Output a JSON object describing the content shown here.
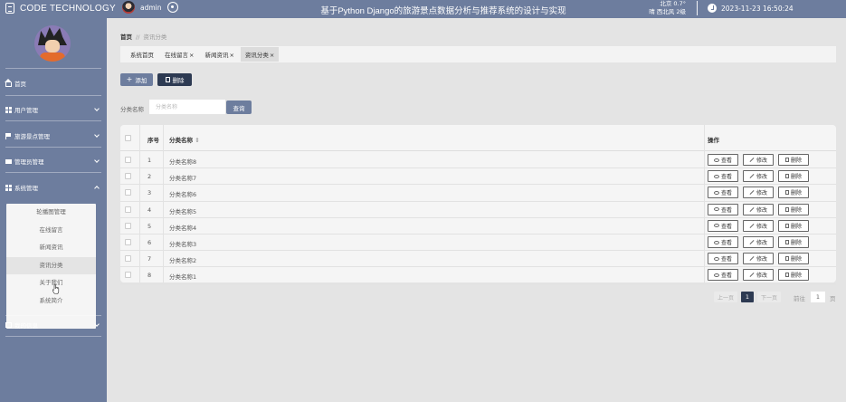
{
  "header": {
    "brand": "CODE TECHNOLOGY",
    "username": "admin",
    "title": "基于Python Django的旅游景点数据分析与推荐系统的设计与实现",
    "weather_line1": "北京 0.7°",
    "weather_line2": "晴 西北风 2级",
    "datetime": "2023-11-23 16:50:24"
  },
  "sidebar": {
    "items": [
      {
        "label": "首页"
      },
      {
        "label": "用户管理"
      },
      {
        "label": "旅游景点管理"
      },
      {
        "label": "管理员管理"
      },
      {
        "label": "系统管理"
      },
      {
        "label": "我的信息"
      }
    ],
    "submenu": [
      {
        "label": "轮播图管理"
      },
      {
        "label": "在线留言"
      },
      {
        "label": "新闻资讯"
      },
      {
        "label": "资讯分类"
      },
      {
        "label": "关于我们"
      },
      {
        "label": "系统简介"
      }
    ]
  },
  "breadcrumb": {
    "home": "首页",
    "sep": "//",
    "current": "资讯分类"
  },
  "tabs": [
    {
      "label": "系统首页",
      "closable": ""
    },
    {
      "label": "在线留言",
      "closable": "×"
    },
    {
      "label": "新闻资讯",
      "closable": "×"
    },
    {
      "label": "资讯分类",
      "closable": "×"
    }
  ],
  "toolbar": {
    "add_label": "添加",
    "add_glyph": "+",
    "delete_label": "删除"
  },
  "search": {
    "label": "分类名称",
    "placeholder": "分类名称",
    "button": "查询"
  },
  "table": {
    "headers": {
      "index": "序号",
      "name": "分类名称",
      "sort": "⇕",
      "actions": "操作"
    },
    "rows": [
      {
        "index": "1",
        "name": "分类名称8"
      },
      {
        "index": "2",
        "name": "分类名称7"
      },
      {
        "index": "3",
        "name": "分类名称6"
      },
      {
        "index": "4",
        "name": "分类名称5"
      },
      {
        "index": "5",
        "name": "分类名称4"
      },
      {
        "index": "6",
        "name": "分类名称3"
      },
      {
        "index": "7",
        "name": "分类名称2"
      },
      {
        "index": "8",
        "name": "分类名称1"
      }
    ],
    "row_actions": {
      "view": "查看",
      "edit": "修改",
      "delete": "删除"
    }
  },
  "pagination": {
    "prev": "上一页",
    "current": "1",
    "next": "下一页",
    "goto": "前往",
    "goto_value": "1",
    "page_suffix": "页"
  },
  "colors": {
    "primary": "#6d7d9e",
    "dark": "#2d3a52",
    "background": "#e4e4e4"
  }
}
